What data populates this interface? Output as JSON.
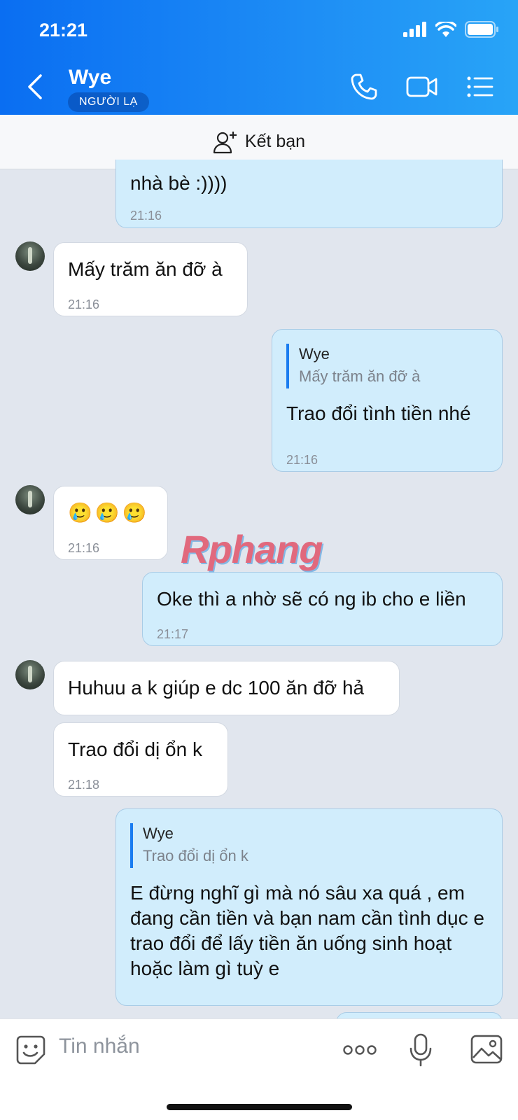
{
  "status_bar": {
    "time": "21:21"
  },
  "header": {
    "contact_name": "Wye",
    "badge": "NGƯỜI LẠ",
    "icons": [
      "chevron-left-icon",
      "phone-icon",
      "video-camera-icon",
      "list-menu-icon"
    ]
  },
  "add_friend": {
    "label": "Kết bạn",
    "icon": "add-person-icon"
  },
  "messages": [
    {
      "side": "out",
      "text": "nhà bè :))))",
      "time": "21:16"
    },
    {
      "side": "in",
      "text": "Mấy trăm ăn đỡ à",
      "time": "21:16"
    },
    {
      "side": "out",
      "quote_name": "Wye",
      "quote_text": "Mấy trăm ăn đỡ à",
      "text": "Trao đổi tình tiền nhé",
      "time": "21:16"
    },
    {
      "side": "in",
      "text": "🥲🥲🥲",
      "time": "21:16"
    },
    {
      "side": "out",
      "text": "Oke thì a nhờ sẽ có ng ib cho e liền",
      "time": "21:17"
    },
    {
      "side": "in",
      "text": "Huhuu a k giúp e dc 100 ăn đỡ hả"
    },
    {
      "side": "in",
      "text": "Trao đổi dị ổn k",
      "time": "21:18"
    },
    {
      "side": "out",
      "quote_name": "Wye",
      "quote_text": "Trao đổi dị ổn k",
      "text": "E đừng nghĩ gì mà nó sâu xa quá , em đang cần tiền và bạn nam cần tình dục e trao đổi để lấy tiền ăn uống sinh hoạt hoặc làm gì tuỳ e"
    }
  ],
  "watermark": "Rphang",
  "composer": {
    "placeholder": "Tin nhắn",
    "icons": [
      "sticker-icon",
      "more-dots-icon",
      "microphone-icon",
      "image-icon"
    ]
  }
}
